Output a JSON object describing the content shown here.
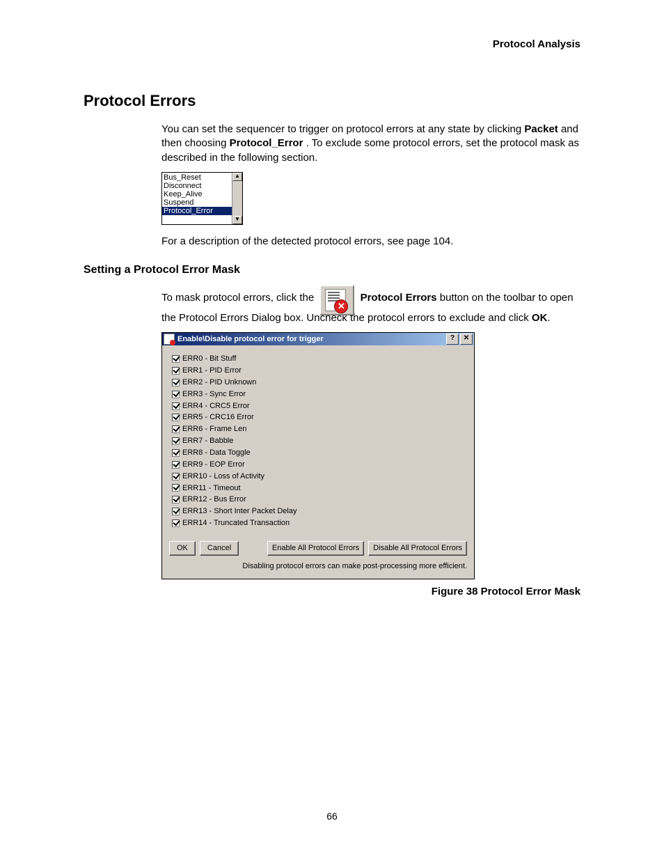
{
  "header": {
    "right": "Protocol Analysis"
  },
  "section": {
    "title": "Protocol Errors",
    "para1_a": "You can set the sequencer to trigger on protocol errors at any state by clicking ",
    "para1_b": " and then choosing ",
    "para1_c": ". To exclude some protocol errors, set the protocol mask as described in the following section.",
    "bold_packet": "Packet",
    "bold_protocol_error": "Protocol_Error",
    "para2": "For a description of the detected protocol errors, see page 104."
  },
  "listbox": {
    "items": [
      "Bus_Reset",
      "Disconnect",
      "Keep_Alive",
      "Suspend",
      "Protocol_Error"
    ],
    "selected_index": 4
  },
  "subsection": {
    "title": "Setting a Protocol Error Mask",
    "p_a": "To mask protocol errors, click the ",
    "p_b": " button on the toolbar to open the Protocol Errors Dialog box. Uncheck the protocol errors to exclude and click ",
    "p_c": ".",
    "bold_pe": "Protocol Errors",
    "bold_ok": "OK"
  },
  "dialog": {
    "title": "Enable\\Disable  protocol error for trigger",
    "errors": [
      "ERR0 - Bit Stuff",
      "ERR1 - PID Error",
      "ERR2 - PID Unknown",
      "ERR3 - Sync Error",
      "ERR4 - CRC5 Error",
      "ERR5 - CRC16 Error",
      "ERR6 - Frame Len",
      "ERR7 - Babble",
      "ERR8 - Data Toggle",
      "ERR9 - EOP Error",
      "ERR10 - Loss of Activity",
      "ERR11 - Timeout",
      "ERR12 - Bus Error",
      "ERR13 - Short Inter Packet Delay",
      "ERR14 - Truncated Transaction"
    ],
    "buttons": {
      "ok": "OK",
      "cancel": "Cancel",
      "enable_all": "Enable All Protocol Errors",
      "disable_all": "Disable All Protocol Errors"
    },
    "footer": "Disabling protocol errors can make post-processing more efficient."
  },
  "figure_caption": "Figure  38  Protocol Error Mask",
  "page_number": "66"
}
